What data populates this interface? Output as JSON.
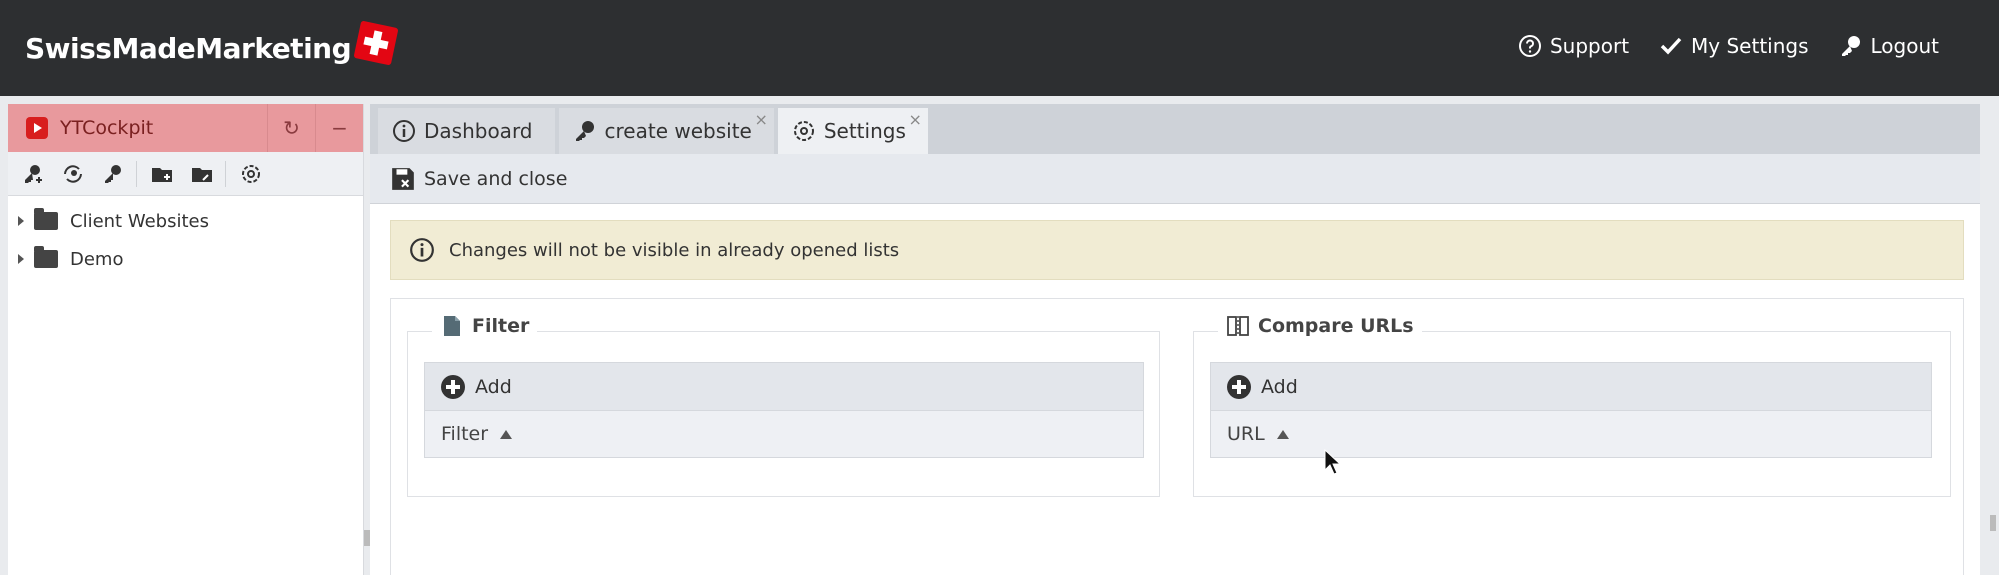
{
  "header": {
    "brand": "SwissMadeMarketing",
    "nav": [
      {
        "label": "Support",
        "icon": "question-circle-icon"
      },
      {
        "label": "My Settings",
        "icon": "checkmark-icon"
      },
      {
        "label": "Logout",
        "icon": "key-icon"
      }
    ]
  },
  "sidebar": {
    "title": "YTCockpit",
    "refresh_symbol": "↻",
    "minimize_symbol": "−",
    "toolbar_icons": [
      "add-key-icon",
      "refresh-key-icon",
      "edit-key-icon",
      "new-folder-icon",
      "edit-folder-icon",
      "gear-icon"
    ],
    "tree": [
      {
        "label": "Client Websites"
      },
      {
        "label": "Demo"
      }
    ]
  },
  "tabs": [
    {
      "label": "Dashboard",
      "icon": "info-icon",
      "closable": false
    },
    {
      "label": "create website",
      "icon": "key-icon",
      "closable": true
    },
    {
      "label": "Settings",
      "icon": "gear-icon",
      "closable": true,
      "active": true
    }
  ],
  "tab_close_symbol": "×",
  "actions": {
    "save_close": "Save and close"
  },
  "notice": {
    "text": "Changes will not be visible in already opened lists"
  },
  "filter_panel": {
    "legend": "Filter",
    "add_label": "Add",
    "column": "Filter"
  },
  "compare_panel": {
    "legend": "Compare URLs",
    "add_label": "Add",
    "column": "URL"
  },
  "colors": {
    "topbar": "#2d2f31",
    "panel_head": "#e8999d",
    "notice_bg": "#f1ecd4"
  }
}
